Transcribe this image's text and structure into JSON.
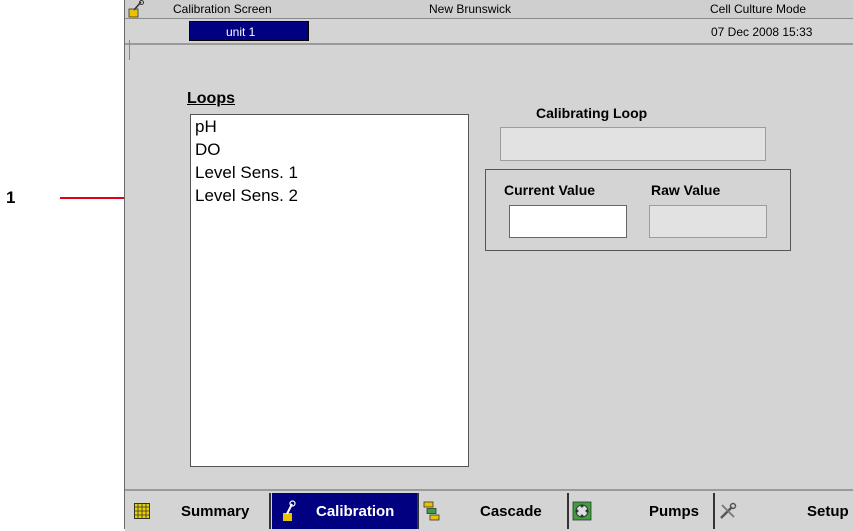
{
  "callout": {
    "number": "1"
  },
  "titlebar": {
    "screen_name": "Calibration Screen",
    "company": "New Brunswick",
    "mode": "Cell Culture Mode"
  },
  "unitbar": {
    "unit_label": "unit 1",
    "datetime": "07 Dec 2008  15:33"
  },
  "loops": {
    "title": "Loops",
    "items": [
      "pH",
      "DO",
      "Level Sens. 1",
      "Level Sens. 2"
    ]
  },
  "calibration": {
    "calibrating_loop_label": "Calibrating Loop",
    "calibrating_loop_value": "",
    "current_value_label": "Current Value",
    "current_value": "",
    "raw_value_label": "Raw Value",
    "raw_value": ""
  },
  "nav": {
    "summary": "Summary",
    "calibration": "Calibration",
    "cascade": "Cascade",
    "pumps": "Pumps",
    "setup": "Setup",
    "active": "calibration"
  },
  "colors": {
    "accent": "#000080",
    "callout_line": "#e0001b",
    "screen_bg": "#d4d4d4"
  }
}
